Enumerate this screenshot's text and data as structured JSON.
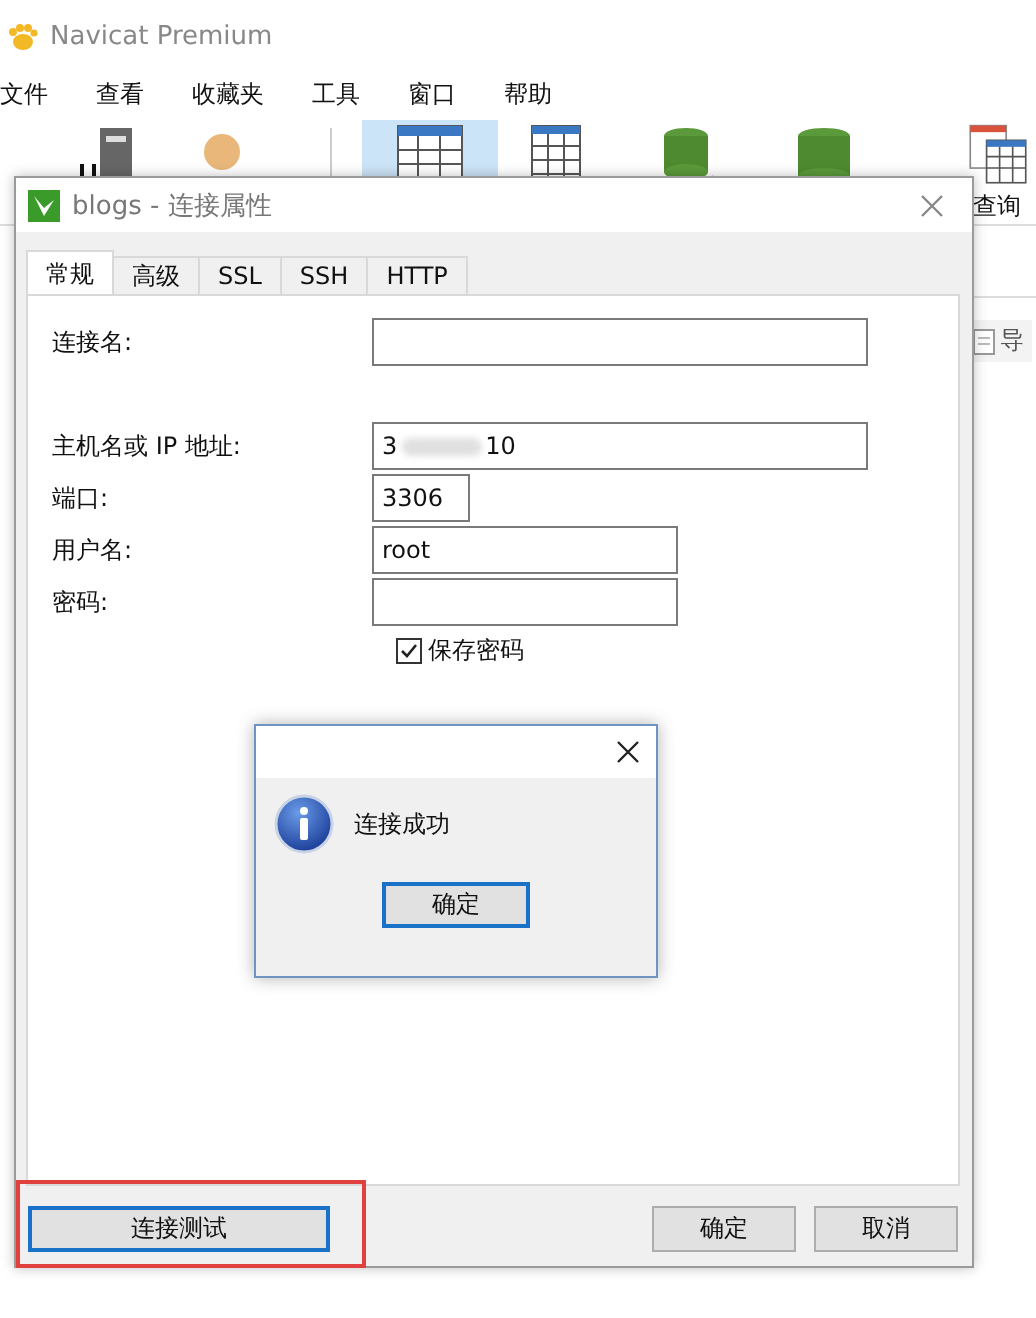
{
  "app_window": {
    "title": "Navicat Premium",
    "menu": [
      "文件",
      "查看",
      "收藏夹",
      "工具",
      "窗口",
      "帮助"
    ],
    "toolbar": [
      {
        "kind": "connection",
        "selected": false
      },
      {
        "kind": "user",
        "selected": false
      },
      {
        "kind": "table",
        "selected": true
      },
      {
        "kind": "view",
        "selected": false
      },
      {
        "kind": "function",
        "selected": false
      },
      {
        "kind": "event",
        "selected": false
      },
      {
        "kind": "query",
        "selected": false,
        "label": "查询"
      }
    ],
    "side_button": "导"
  },
  "dialog": {
    "title": "blogs - 连接属性",
    "tabs": [
      {
        "label": "常规",
        "selected": true
      },
      {
        "label": "高级",
        "selected": false
      },
      {
        "label": "SSL",
        "selected": false
      },
      {
        "label": "SSH",
        "selected": false
      },
      {
        "label": "HTTP",
        "selected": false
      }
    ],
    "fields": [
      {
        "label": "连接名:"
      },
      {
        "label": "主机名或 IP 地址:",
        "value": "3",
        "value_tail": "10",
        "blurred": true
      },
      {
        "label": "端口:",
        "value": "3306"
      },
      {
        "label": "用户名:",
        "value": "root"
      },
      {
        "label": "密码:"
      }
    ],
    "save_password": {
      "label": "保存密码",
      "checked": true
    },
    "test_button": {
      "label": "连接测试",
      "highlighted": true
    },
    "buttons": [
      "确定",
      "取消"
    ]
  },
  "message_box": {
    "message": "连接成功",
    "button": "确定"
  }
}
